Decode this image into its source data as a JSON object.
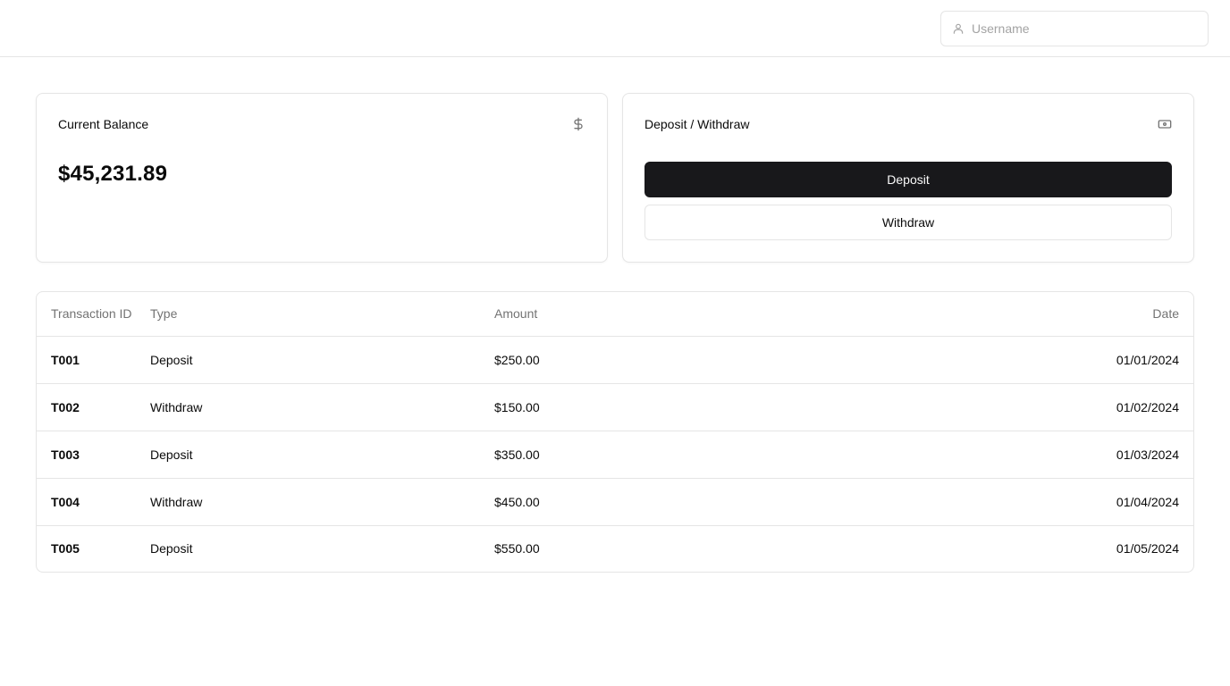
{
  "header": {
    "username_placeholder": "Username",
    "username_value": "",
    "user_icon": "user-icon"
  },
  "balance_card": {
    "title": "Current Balance",
    "icon": "dollar-sign-icon",
    "value": "$45,231.89"
  },
  "actions_card": {
    "title": "Deposit / Withdraw",
    "icon": "banknote-icon",
    "deposit_label": "Deposit",
    "withdraw_label": "Withdraw"
  },
  "transactions": {
    "columns": [
      "Transaction ID",
      "Type",
      "Amount",
      "Date"
    ],
    "rows": [
      {
        "id": "T001",
        "type": "Deposit",
        "amount": "$250.00",
        "date": "01/01/2024"
      },
      {
        "id": "T002",
        "type": "Withdraw",
        "amount": "$150.00",
        "date": "01/02/2024"
      },
      {
        "id": "T003",
        "type": "Deposit",
        "amount": "$350.00",
        "date": "01/03/2024"
      },
      {
        "id": "T004",
        "type": "Withdraw",
        "amount": "$450.00",
        "date": "01/04/2024"
      },
      {
        "id": "T005",
        "type": "Deposit",
        "amount": "$550.00",
        "date": "01/05/2024"
      }
    ]
  },
  "colors": {
    "primary": "#18181b",
    "border": "#e5e5e5",
    "muted_text": "#737373"
  }
}
